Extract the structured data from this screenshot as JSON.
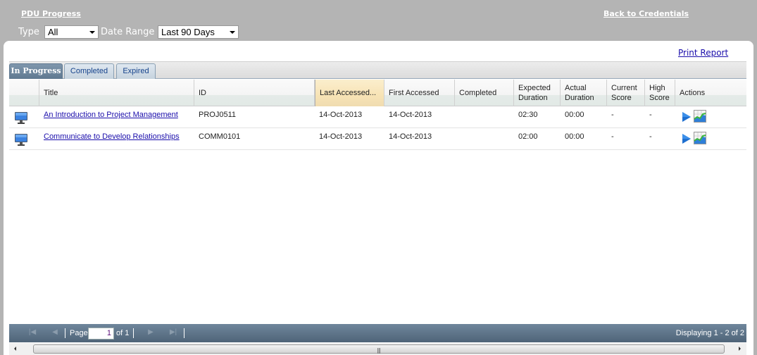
{
  "header": {
    "title": "PDU Progress",
    "back_link": "Back to Credentials"
  },
  "filters": {
    "type_label": "Type",
    "type_value": "All",
    "date_range_label": "Date Range",
    "date_range_value": "Last 90 Days"
  },
  "print_report": "Print Report",
  "tabs": [
    {
      "label": "In Progress",
      "active": true
    },
    {
      "label": "Completed",
      "active": false
    },
    {
      "label": "Expired",
      "active": false
    }
  ],
  "columns": {
    "title": "Title",
    "id": "ID",
    "last_accessed": "Last Accessed...",
    "first_accessed": "First Accessed",
    "completed": "Completed",
    "expected_duration": "Expected Duration",
    "actual_duration": "Actual Duration",
    "current_score": "Current Score",
    "high_score": "High Score",
    "actions": "Actions"
  },
  "rows": [
    {
      "icon": "computer-monitor-icon",
      "title": "An Introduction to Project Management",
      "id": "PROJ0511",
      "last_accessed": "14-Oct-2013",
      "first_accessed": "14-Oct-2013",
      "completed": "",
      "expected_duration": "02:30",
      "actual_duration": "00:00",
      "current_score": "-",
      "high_score": "-"
    },
    {
      "icon": "computer-monitor-icon",
      "title": "Communicate to Develop Relationships",
      "id": "COMM0101",
      "last_accessed": "14-Oct-2013",
      "first_accessed": "14-Oct-2013",
      "completed": "",
      "expected_duration": "02:00",
      "actual_duration": "00:00",
      "current_score": "-",
      "high_score": "-"
    }
  ],
  "pager": {
    "page_label": "Page",
    "page_value": "1",
    "of_label": "of 1",
    "display_text": "Displaying 1 - 2 of 2"
  }
}
